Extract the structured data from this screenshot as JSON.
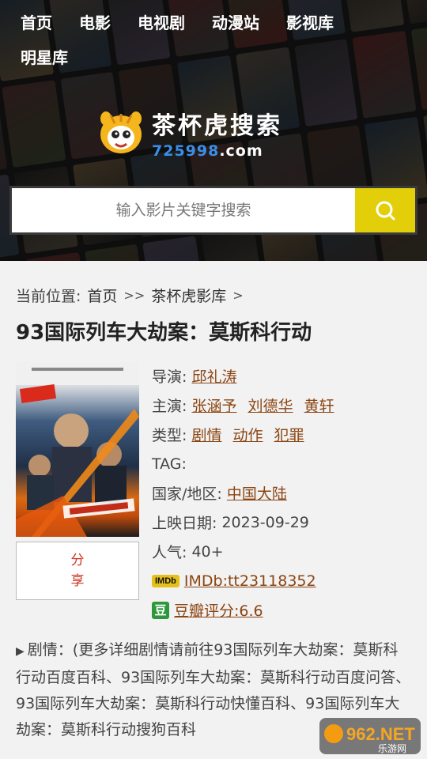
{
  "nav": {
    "items": [
      "首页",
      "电影",
      "电视剧",
      "动漫站",
      "影视库"
    ],
    "items_row2": [
      "明星库"
    ]
  },
  "logo": {
    "title": "茶杯虎搜索",
    "domain_num": "725998",
    "domain_tld": ".com"
  },
  "search": {
    "placeholder": "输入影片关键字搜索",
    "icon": "search-icon"
  },
  "breadcrumb": {
    "label": "当前位置:",
    "home": "首页",
    "sep1": ">>",
    "section": "茶杯虎影库",
    "sep2": ">"
  },
  "movie": {
    "title": "93国际列车大劫案：莫斯科行动",
    "director_label": "导演:",
    "director": "邱礼涛",
    "cast_label": "主演:",
    "cast": [
      "张涵予",
      "刘德华",
      "黄轩"
    ],
    "genre_label": "类型:",
    "genres": [
      "剧情",
      "动作",
      "犯罪"
    ],
    "tag_label": "TAG:",
    "region_label": "国家/地区:",
    "region": "中国大陆",
    "release_label": "上映日期:",
    "release_date": "2023-09-29",
    "popularity_label": "人气:",
    "popularity": "40+",
    "imdb_badge": "IMDb",
    "imdb": "IMDb:tt23118352",
    "douban_badge": "豆",
    "douban": "豆瓣评分:6.6",
    "share_line1": "分",
    "share_line2": "享"
  },
  "plot": {
    "text": "剧情：(更多详细剧情请前往93国际列车大劫案：莫斯科行动百度百科、93国际列车大劫案：莫斯科行动百度问答、93国际列车大劫案：莫斯科行动快懂百科、93国际列车大劫案：莫斯科行动搜狗百科"
  },
  "watermark": {
    "brand": "962.NET",
    "sub": "乐游网"
  },
  "colors": {
    "accent_yellow": "#e2cf0a",
    "link_brown": "#8b4513",
    "share_red": "#d0321f",
    "domain_blue": "#3b8ee6",
    "douban_green": "#2e963d",
    "imdb_yellow": "#e6c01a"
  }
}
